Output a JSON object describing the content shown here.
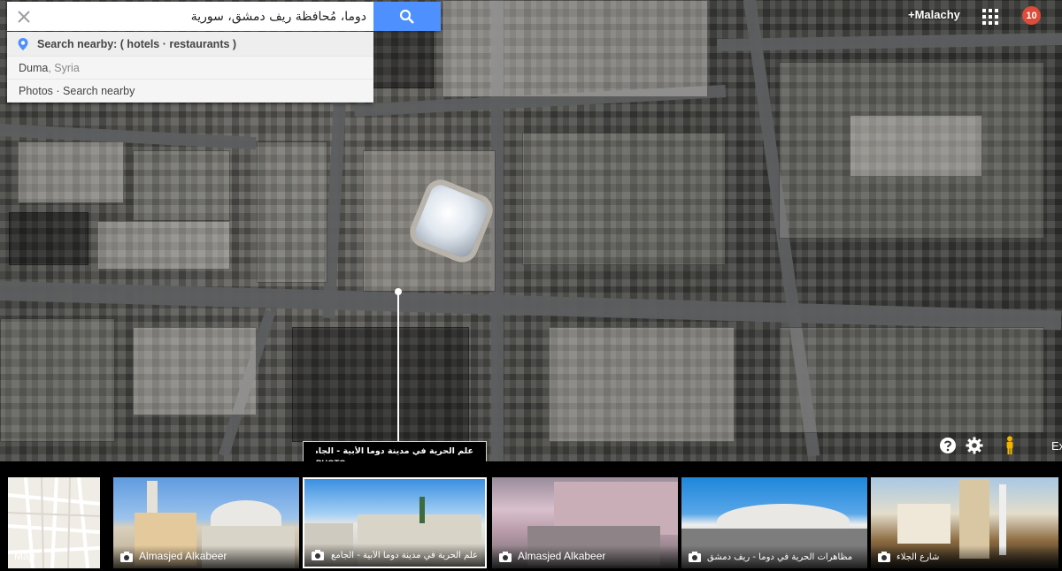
{
  "search": {
    "value": "دوما، مُحافظة ريف دمشق، سورية",
    "clear_icon": "close-icon",
    "search_icon": "search-icon"
  },
  "suggestions": [
    {
      "label": "Search nearby: ( hotels · restaurants )",
      "icon": "location-pin-icon"
    },
    {
      "label": "Duma",
      "sub": ", Syria"
    },
    {
      "label": "Photos · Search nearby"
    }
  ],
  "header": {
    "user": "+Malachy",
    "notifications": "10",
    "apps_icon": "apps-grid-icon"
  },
  "controls": {
    "help_icon": "help-icon",
    "settings_icon": "gear-icon",
    "streetview_icon": "pegman-icon",
    "expand_label": "Ex"
  },
  "tooltip": {
    "title": "علم الحرية في مدينة دوما الأبية - الجامع الكبير",
    "type": "PHOTO"
  },
  "filmstrip": {
    "map_label": "Map",
    "photos": [
      {
        "caption": "Almasjed Alkabeer",
        "rtl": false
      },
      {
        "caption": "علم الحرية في مدينة دوما الأبية - الجامع الكبير",
        "rtl": true
      },
      {
        "caption": "Almasjed Alkabeer",
        "rtl": false
      },
      {
        "caption": "مظاهرات الحرية في دوما - ريف دمشق",
        "rtl": true
      },
      {
        "caption": "شارع الجلاء",
        "rtl": true
      }
    ]
  },
  "colors": {
    "search_button": "#4d90fe",
    "notification_badge": "#dd4b39",
    "pegman": "#f5b400"
  }
}
